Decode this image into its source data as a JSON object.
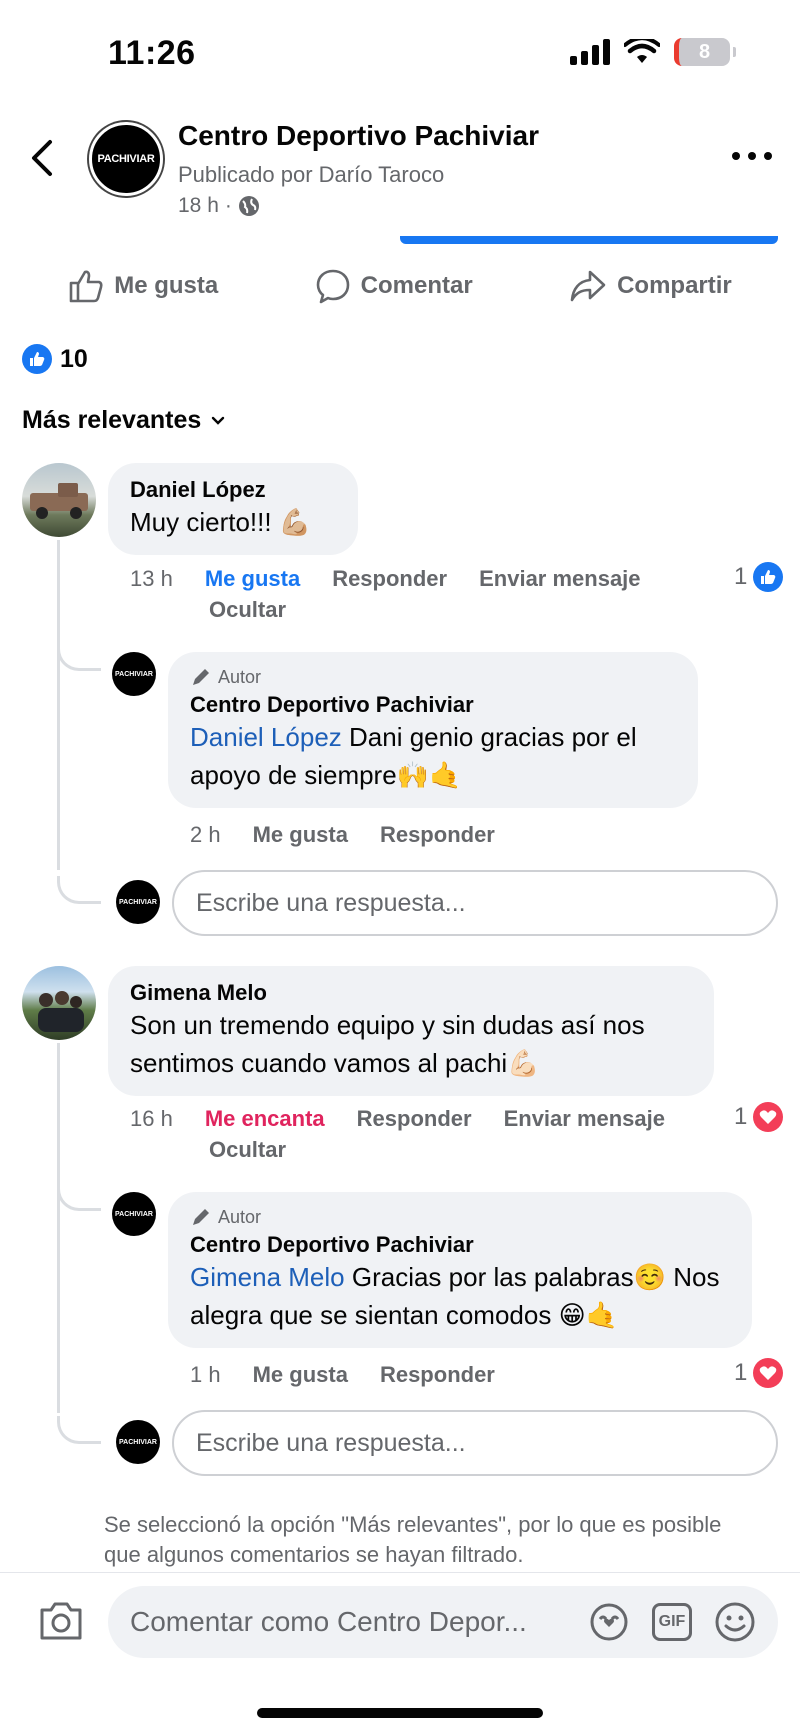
{
  "status_bar": {
    "time": "11:26",
    "battery": "8"
  },
  "header": {
    "page_name": "Centro Deportivo Pachiviar",
    "published_by": "Publicado por Darío Taroco",
    "time": "18 h",
    "visibility_separator": "·",
    "logo_text": "PACHIVIAR"
  },
  "actions": {
    "like": "Me gusta",
    "comment": "Comentar",
    "share": "Compartir"
  },
  "reactions": {
    "count": "10"
  },
  "sort": {
    "label": "Más relevantes"
  },
  "comments": [
    {
      "author": "Daniel López",
      "text": "Muy cierto!!! 💪🏼",
      "time": "13 h",
      "like": "Me gusta",
      "reply": "Responder",
      "message": "Enviar mensaje",
      "hide": "Ocultar",
      "reaction_count": "1",
      "reaction_type": "like",
      "reply_item": {
        "author_tag": "Autor",
        "author": "Centro Deportivo Pachiviar",
        "mention": "Daniel López",
        "text": " Dani genio gracias por el apoyo de siempre🙌🤙",
        "time": "2 h",
        "like": "Me gusta",
        "reply": "Responder"
      },
      "reply_placeholder": "Escribe una respuesta..."
    },
    {
      "author": "Gimena Melo",
      "text": "Son un tremendo equipo y sin dudas así nos sentimos cuando vamos al pachi💪🏻",
      "time": "16 h",
      "like": "Me encanta",
      "reply": "Responder",
      "message": "Enviar mensaje",
      "hide": "Ocultar",
      "reaction_count": "1",
      "reaction_type": "love",
      "reply_item": {
        "author_tag": "Autor",
        "author": "Centro Deportivo Pachiviar",
        "mention": "Gimena Melo",
        "text": " Gracias por las palabras☺️ Nos alegra que se sientan comodos 😁🤙",
        "time": "1 h",
        "like": "Me gusta",
        "reply": "Responder",
        "reaction_count": "1"
      },
      "reply_placeholder": "Escribe una respuesta..."
    }
  ],
  "filter_notice": "Se seleccionó la opción \"Más relevantes\", por lo que es posible que algunos comentarios se hayan filtrado.",
  "composer": {
    "placeholder": "Comentar como Centro Depor...",
    "gif_label": "GIF"
  },
  "colors": {
    "accent": "#1877f2",
    "love": "#f33e58",
    "muted": "#65676b",
    "bubble": "#f0f2f5"
  }
}
